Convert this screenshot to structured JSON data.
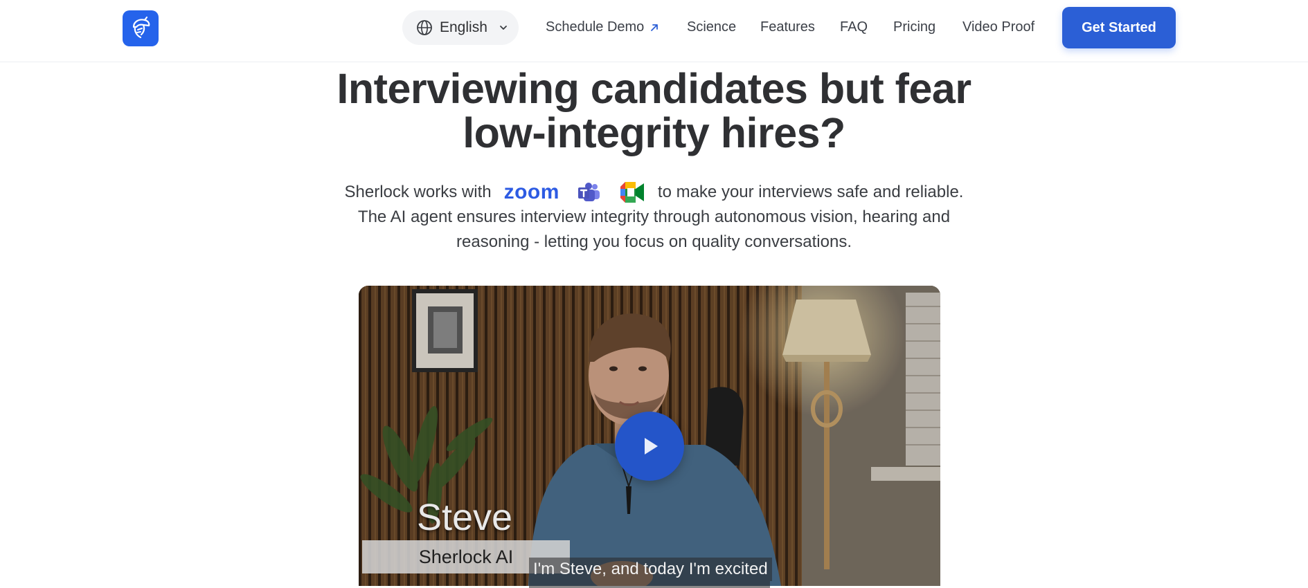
{
  "header": {
    "logo_name": "sherlock-logo",
    "language": "English",
    "nav": [
      {
        "label": "Schedule Demo",
        "external": true
      },
      {
        "label": "Science"
      },
      {
        "label": "Features"
      },
      {
        "label": "FAQ"
      },
      {
        "label": "Pricing"
      },
      {
        "label": "Video Proof"
      }
    ],
    "cta_label": "Get Started"
  },
  "hero": {
    "headline_line1": "Interviewing candidates but fear",
    "headline_line2": "low-integrity hires?",
    "sub_prefix": "Sherlock works with",
    "zoom_wordmark": "zoom",
    "sub_suffix": "to make your interviews safe and reliable.",
    "sub_line2": "The AI agent ensures interview integrity through autonomous vision, hearing and",
    "sub_line3": "reasoning - letting you focus on quality conversations.",
    "integration_icons": [
      "zoom-logo",
      "microsoft-teams-icon",
      "google-meet-icon"
    ]
  },
  "video": {
    "speaker_name": "Steve",
    "speaker_org": "Sherlock  AI",
    "caption": "I'm Steve, and today I'm excited"
  },
  "colors": {
    "brand_blue": "#2b5fd6",
    "text_dark": "#2f3033",
    "zoom_blue": "#2d5be3",
    "teams_purple": "#5059c9"
  }
}
